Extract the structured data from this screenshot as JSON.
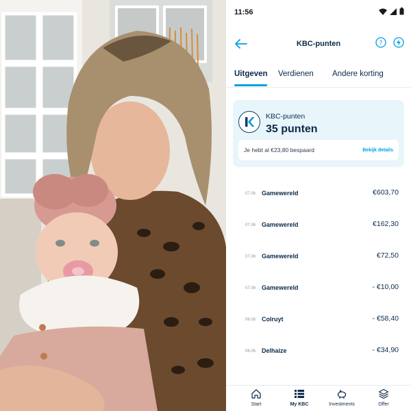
{
  "status": {
    "time": "11:56"
  },
  "header": {
    "title": "KBC-punten"
  },
  "tabs": [
    {
      "label": "Uitgeven",
      "active": true
    },
    {
      "label": "Verdienen",
      "active": false
    },
    {
      "label": "Andere korting",
      "active": false
    }
  ],
  "card": {
    "label": "KBC-punten",
    "points": "35 punten",
    "saved_text": "Je hebt al €23,80 bespaard",
    "details_link": "Bekijk details"
  },
  "transactions": [
    {
      "date": "07.06",
      "merchant": "Gamewereld",
      "amount": "€603,70"
    },
    {
      "date": "07.06",
      "merchant": "Gamewereld",
      "amount": "€162,30"
    },
    {
      "date": "07.06",
      "merchant": "Gamewereld",
      "amount": "€72,50"
    },
    {
      "date": "07.06",
      "merchant": "Gamewereld",
      "amount": "- €10,00"
    },
    {
      "date": "06.06",
      "merchant": "Colruyt",
      "amount": "- €58,40"
    },
    {
      "date": "06.06",
      "merchant": "Delhaize",
      "amount": "- €34,90"
    }
  ],
  "bottom_nav": [
    {
      "label": "Start",
      "icon": "home-icon",
      "active": false
    },
    {
      "label": "My KBC",
      "icon": "list-icon",
      "active": true
    },
    {
      "label": "Investments",
      "icon": "piggy-bank-icon",
      "active": false
    },
    {
      "label": "Offer",
      "icon": "layers-icon",
      "active": false
    }
  ],
  "colors": {
    "accent": "#009fe3",
    "navy": "#0b2a4a",
    "card_bg": "#e8f5fb"
  }
}
